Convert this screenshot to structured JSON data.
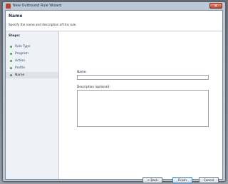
{
  "window": {
    "title": "New Outbound Rule Wizard",
    "close_glyph": "✕",
    "page_title": "Name",
    "page_subtitle": "Specify the name and description of this rule."
  },
  "steps": {
    "label": "Steps:",
    "items": [
      {
        "label": "Rule Type",
        "active": false
      },
      {
        "label": "Program",
        "active": false
      },
      {
        "label": "Action",
        "active": false
      },
      {
        "label": "Profile",
        "active": false
      },
      {
        "label": "Name",
        "active": true
      }
    ]
  },
  "form": {
    "name_label": "Name:",
    "name_value": "",
    "description_label": "Description (optional):",
    "description_value": ""
  },
  "buttons": {
    "back": "< Back",
    "finish": "Finish",
    "cancel": "Cancel"
  },
  "colors": {
    "step_dot": "#3ea33a",
    "primary_button_border": "#3b84c6"
  }
}
